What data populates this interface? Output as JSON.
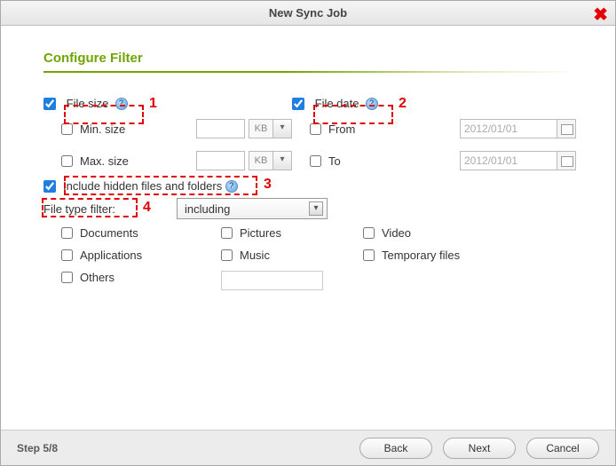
{
  "window": {
    "title": "New Sync Job"
  },
  "section": {
    "title": "Configure Filter"
  },
  "filesize": {
    "label": "File size",
    "checked": true,
    "min": {
      "label": "Min. size",
      "checked": false,
      "value": "",
      "unit": "KB"
    },
    "max": {
      "label": "Max. size",
      "checked": false,
      "value": "",
      "unit": "KB"
    }
  },
  "filedate": {
    "label": "File date",
    "checked": true,
    "from": {
      "label": "From",
      "checked": false,
      "value": "2012/01/01"
    },
    "to": {
      "label": "To",
      "checked": false,
      "value": "2012/01/01"
    }
  },
  "hidden": {
    "label": "Include hidden files and folders",
    "checked": true
  },
  "filetype": {
    "label": "File type filter:",
    "mode": "including",
    "items": {
      "documents": {
        "label": "Documents",
        "checked": false
      },
      "applications": {
        "label": "Applications",
        "checked": false
      },
      "others": {
        "label": "Others",
        "checked": false,
        "value": ""
      },
      "pictures": {
        "label": "Pictures",
        "checked": false
      },
      "music": {
        "label": "Music",
        "checked": false
      },
      "video": {
        "label": "Video",
        "checked": false
      },
      "temporary": {
        "label": "Temporary files",
        "checked": false
      }
    }
  },
  "annotations": {
    "n1": "1",
    "n2": "2",
    "n3": "3",
    "n4": "4"
  },
  "footer": {
    "step": "Step 5/8",
    "back": "Back",
    "next": "Next",
    "cancel": "Cancel"
  }
}
